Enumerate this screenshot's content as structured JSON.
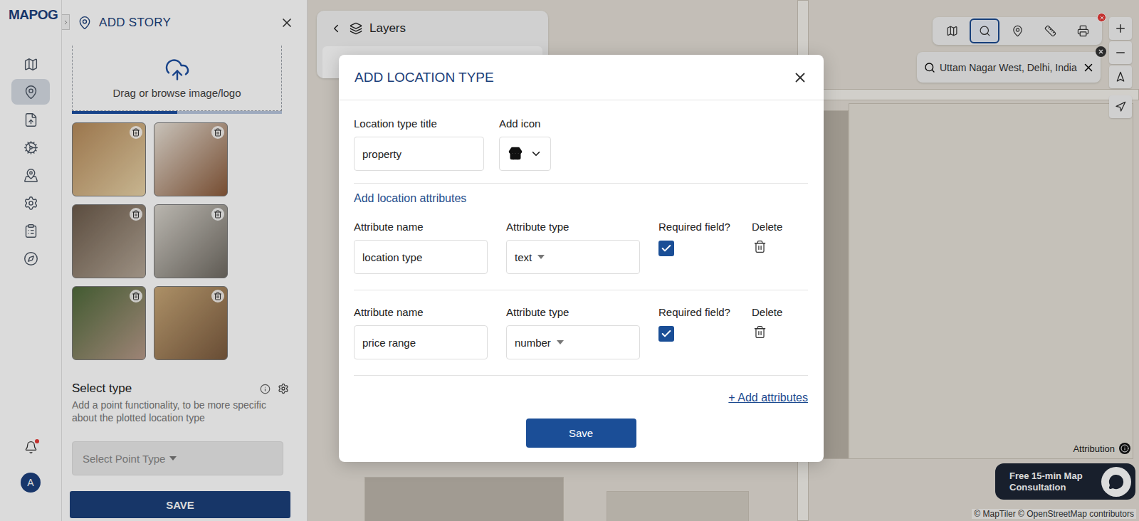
{
  "logo": "MAPOG",
  "rail": {
    "items": [
      {
        "selected": false
      },
      {
        "selected": true
      },
      {
        "selected": false
      },
      {
        "selected": false
      },
      {
        "selected": false
      },
      {
        "selected": false
      },
      {
        "selected": false
      },
      {
        "selected": false
      }
    ],
    "notification": true,
    "avatar": "A"
  },
  "story_panel": {
    "title": "ADD STORY",
    "upload": {
      "text": "Drag or browse image/logo",
      "level": 0.5
    },
    "photos": [
      {
        "removable": true
      },
      {
        "removable": true
      },
      {
        "removable": true
      },
      {
        "removable": true
      },
      {
        "removable": true
      },
      {
        "removable": true
      }
    ],
    "select_type": {
      "label": "Select type",
      "help": "Add a point functionality, to be more specific about the plotted location type",
      "placeholder": "Select Point Type",
      "disabled": true
    },
    "save": "SAVE"
  },
  "map": {
    "layers_title": "Layers",
    "tools": [
      {
        "selected": false
      },
      {
        "selected": true
      },
      {
        "selected": false
      },
      {
        "selected": false
      },
      {
        "selected": false
      }
    ],
    "tool_badge": true,
    "search": {
      "value": "Uttam Nagar West, Delhi, India"
    },
    "attribution": "Attribution",
    "consultation": "Free 15-min Map Consultation",
    "credits": "© MapTiler © OpenStreetMap contributors"
  },
  "modal": {
    "title": "ADD LOCATION TYPE",
    "title_label": "Location type title",
    "title_value": "property",
    "icon_label": "Add icon",
    "attributes_heading": "Add location attributes",
    "columns": [
      "Attribute name",
      "Attribute type",
      "Required field?",
      "Delete"
    ],
    "attributes": [
      {
        "name": "location type",
        "type": "text",
        "required": true
      },
      {
        "name": "price range",
        "type": "number",
        "required": true
      }
    ],
    "add_link": "+ Add attributes",
    "save": "Save"
  }
}
